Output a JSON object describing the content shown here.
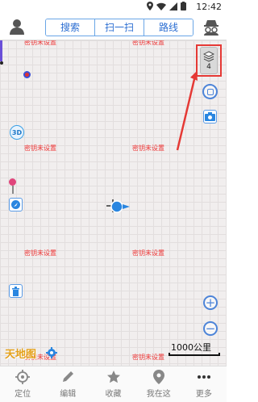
{
  "status_bar": {
    "time": "12:42"
  },
  "top_tabs": [
    "搜索",
    "扫一扫",
    "路线"
  ],
  "map": {
    "tile_labels": [
      "密钥未设置",
      "密钥未设置",
      "密钥未设置",
      "密钥未设置",
      "密钥未设置",
      "密钥未设置",
      "密钥未设置",
      "密钥未设置",
      "密钥未设置",
      "密钥未设置"
    ],
    "layers_count": "4",
    "scale_label": "1000公里",
    "logo_text": "天地图"
  },
  "bottom_nav": [
    "定位",
    "编辑",
    "收藏",
    "我在这",
    "更多"
  ],
  "colors": {
    "accent": "#2b6ed2",
    "highlight": "#e53935",
    "tile_label": "#e33"
  }
}
